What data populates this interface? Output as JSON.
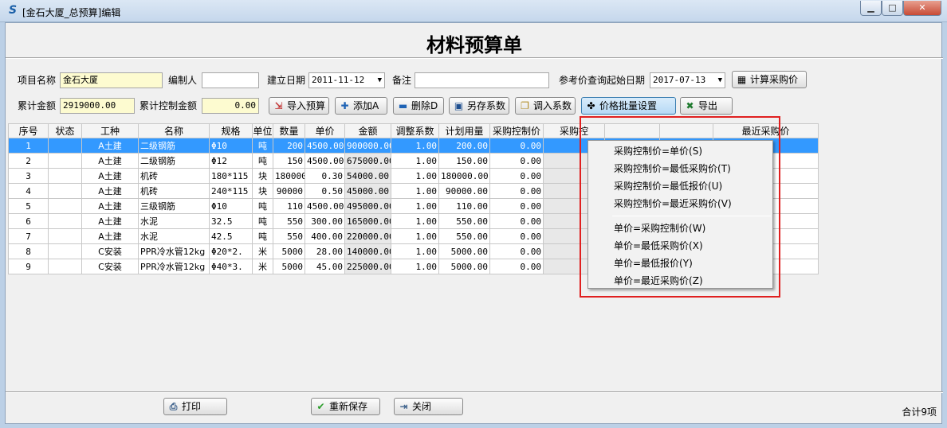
{
  "window": {
    "title": "[金石大厦_总预算]编辑",
    "minimize": "▁",
    "maximize": "□",
    "close": "✕"
  },
  "heading": "材料预算单",
  "form": {
    "project_name_label": "项目名称",
    "project_name_value": "金石大厦",
    "editor_label": "编制人",
    "editor_value": "",
    "created_date_label": "建立日期",
    "created_date_value": "2011-11-12",
    "note_label": "备注",
    "note_value": "",
    "ref_price_date_label": "参考价查询起始日期",
    "ref_price_date_value": "2017-07-13",
    "total_amount_label": "累计金额",
    "total_amount_value": "2919000.00",
    "total_control_label": "累计控制金额",
    "total_control_value": "0.00"
  },
  "toolbar": {
    "calc_price": "计算采购价",
    "import_budget": "导入预算",
    "add": "添加A",
    "delete": "删除D",
    "save_coeff": "另存系数",
    "load_coeff": "调入系数",
    "batch_price": "价格批量设置",
    "export": "导出"
  },
  "table": {
    "columns": [
      "序号",
      "状态",
      "工种",
      "名称",
      "规格",
      "单位",
      "数量",
      "单价",
      "金额",
      "调整系数",
      "计划用量",
      "采购控制价",
      "采购控",
      "",
      "",
      "最近采购价"
    ],
    "rows": [
      [
        "1",
        "",
        "A土建",
        "二级钢筋",
        "Φ10",
        "吨",
        "200",
        "4500.00",
        "900000.00",
        "1.00",
        "200.00",
        "0.00"
      ],
      [
        "2",
        "",
        "A土建",
        "二级钢筋",
        "Φ12",
        "吨",
        "150",
        "4500.00",
        "675000.00",
        "1.00",
        "150.00",
        "0.00"
      ],
      [
        "3",
        "",
        "A土建",
        "机砖",
        "180*115",
        "块",
        "180000",
        "0.30",
        "54000.00",
        "1.00",
        "180000.00",
        "0.00"
      ],
      [
        "4",
        "",
        "A土建",
        "机砖",
        "240*115",
        "块",
        "90000",
        "0.50",
        "45000.00",
        "1.00",
        "90000.00",
        "0.00"
      ],
      [
        "5",
        "",
        "A土建",
        "三级钢筋",
        "Φ10",
        "吨",
        "110",
        "4500.00",
        "495000.00",
        "1.00",
        "110.00",
        "0.00"
      ],
      [
        "6",
        "",
        "A土建",
        "水泥",
        "32.5",
        "吨",
        "550",
        "300.00",
        "165000.00",
        "1.00",
        "550.00",
        "0.00"
      ],
      [
        "7",
        "",
        "A土建",
        "水泥",
        "42.5",
        "吨",
        "550",
        "400.00",
        "220000.00",
        "1.00",
        "550.00",
        "0.00"
      ],
      [
        "8",
        "",
        "C安装",
        "PPR冷水管12kg",
        "Φ20*2.",
        "米",
        "5000",
        "28.00",
        "140000.00",
        "1.00",
        "5000.00",
        "0.00"
      ],
      [
        "9",
        "",
        "C安装",
        "PPR冷水管12kg",
        "Φ40*3.",
        "米",
        "5000",
        "45.00",
        "225000.00",
        "1.00",
        "5000.00",
        "0.00"
      ]
    ]
  },
  "menu": {
    "items_a": [
      "采购控制价=单价(S)",
      "采购控制价=最低采购价(T)",
      "采购控制价=最低报价(U)",
      "采购控制价=最近采购价(V)"
    ],
    "items_b": [
      "单价=采购控制价(W)",
      "单价=最低采购价(X)",
      "单价=最低报价(Y)",
      "单价=最近采购价(Z)"
    ]
  },
  "footer": {
    "print": "打印",
    "resave": "重新保存",
    "close": "关闭",
    "total_count": "合计9项"
  },
  "colors": {
    "selected_row": "#3399ff",
    "highlight_border": "#e02020",
    "yellow_field": "#fdfbd0"
  }
}
